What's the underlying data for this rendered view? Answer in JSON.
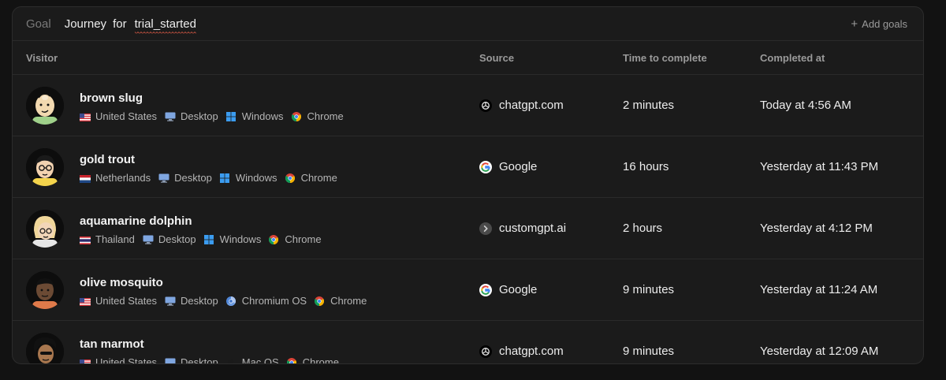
{
  "header": {
    "tab_goal": "Goal",
    "tab_journey": "Journey",
    "word_for": "for",
    "event_name": "trial_started",
    "add_goals": "Add goals"
  },
  "columns": {
    "visitor": "Visitor",
    "source": "Source",
    "time": "Time to complete",
    "completed": "Completed at"
  },
  "rows": [
    {
      "name": "brown slug",
      "country": "United States",
      "device": "Desktop",
      "os": "Windows",
      "browser": "Chrome",
      "source": "chatgpt.com",
      "time": "2 minutes",
      "completed": "Today at 4:56 AM"
    },
    {
      "name": "gold trout",
      "country": "Netherlands",
      "device": "Desktop",
      "os": "Windows",
      "browser": "Chrome",
      "source": "Google",
      "time": "16 hours",
      "completed": "Yesterday at 11:43 PM"
    },
    {
      "name": "aquamarine dolphin",
      "country": "Thailand",
      "device": "Desktop",
      "os": "Windows",
      "browser": "Chrome",
      "source": "customgpt.ai",
      "time": "2 hours",
      "completed": "Yesterday at 4:12 PM"
    },
    {
      "name": "olive mosquito",
      "country": "United States",
      "device": "Desktop",
      "os": "Chromium OS",
      "browser": "Chrome",
      "source": "Google",
      "time": "9 minutes",
      "completed": "Yesterday at 11:24 AM"
    },
    {
      "name": "tan marmot",
      "country": "United States",
      "device": "Desktop",
      "os": "Mac OS",
      "browser": "Chrome",
      "source": "chatgpt.com",
      "time": "9 minutes",
      "completed": "Yesterday at 12:09 AM"
    }
  ],
  "icons": {
    "flags": [
      "us-flag-icon",
      "nl-flag-icon",
      "th-flag-icon",
      "us-flag-icon",
      "us-flag-icon"
    ],
    "device": "desktop-icon",
    "os": [
      "windows-icon",
      "windows-icon",
      "windows-icon",
      "chromium-icon",
      "apple-icon"
    ],
    "browser": "chrome-icon",
    "sources": [
      "chatgpt-icon",
      "google-icon",
      "customgpt-icon",
      "google-icon",
      "chatgpt-icon"
    ]
  },
  "colors": {
    "background": "#121212",
    "panel": "#1b1b1b",
    "muted_text": "#9a9a9a",
    "event_underline": "#c0503f",
    "desktop_icon": "#7fa6e0",
    "windows_icon": "#3b9cf0"
  }
}
